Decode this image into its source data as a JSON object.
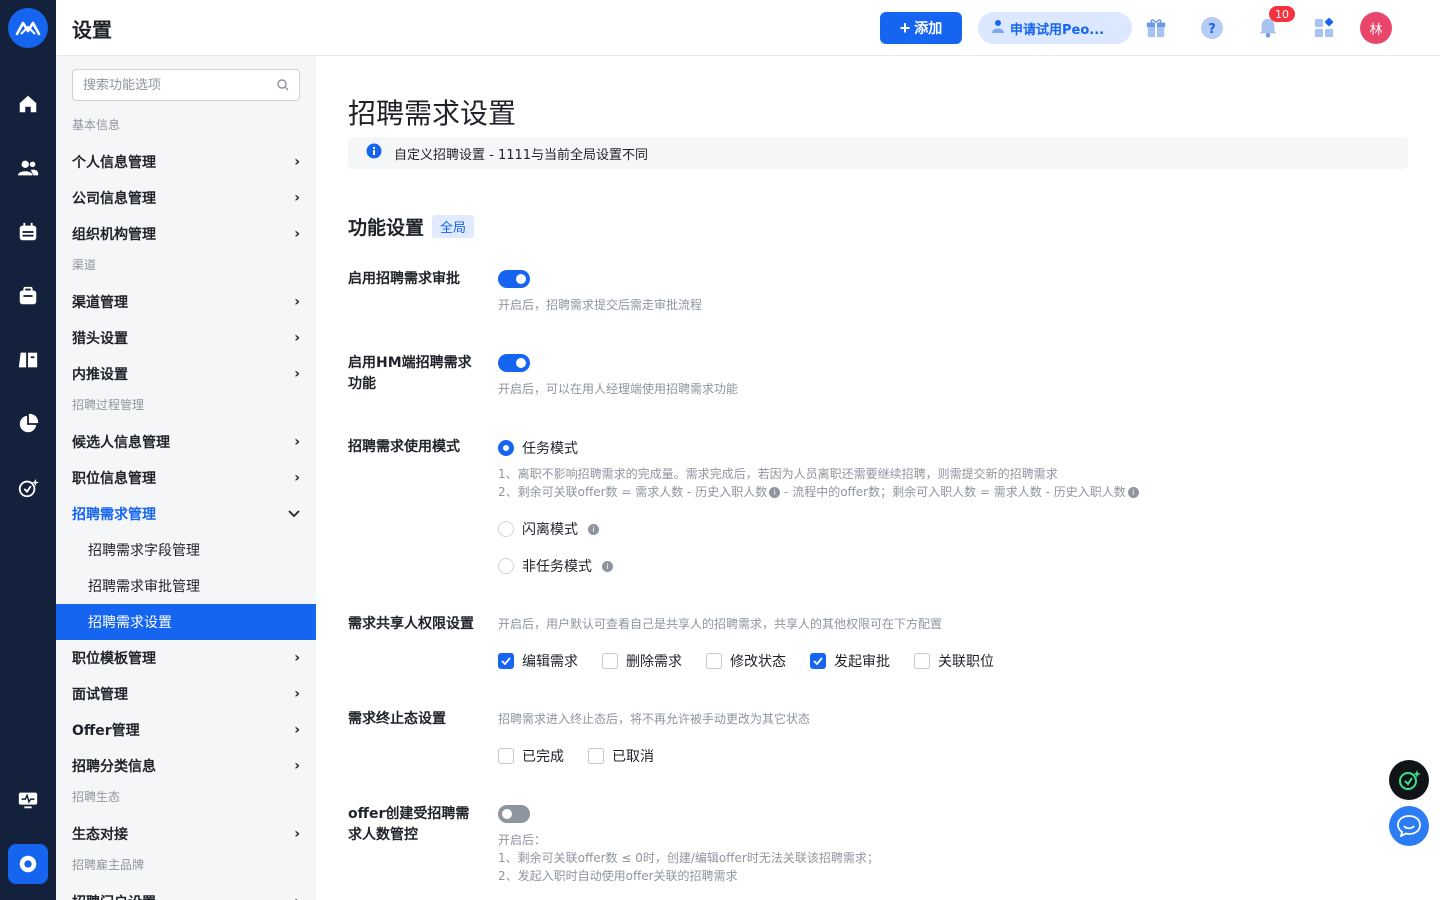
{
  "header": {
    "title": "设置",
    "add_label": "添加",
    "trial_label": "申请试用Peo...",
    "notification_count": "10",
    "avatar_text": "林"
  },
  "sidebar": {
    "search_placeholder": "搜索功能选项",
    "sections": [
      {
        "title": "基本信息",
        "items": [
          "个人信息管理",
          "公司信息管理",
          "组织机构管理"
        ]
      },
      {
        "title": "渠道",
        "items": [
          "渠道管理",
          "猎头设置",
          "内推设置"
        ]
      },
      {
        "title": "招聘过程管理",
        "items": [
          "候选人信息管理",
          "职位信息管理",
          "招聘需求管理"
        ],
        "open_item": "招聘需求管理",
        "sub_items": [
          "招聘需求字段管理",
          "招聘需求审批管理",
          "招聘需求设置"
        ],
        "selected_sub": "招聘需求设置",
        "after_items": [
          "职位模板管理",
          "面试管理",
          "Offer管理",
          "招聘分类信息"
        ]
      },
      {
        "title": "招聘生态",
        "items": [
          "生态对接"
        ]
      },
      {
        "title": "招聘雇主品牌",
        "items": [
          "招聘门户设置"
        ]
      }
    ]
  },
  "main": {
    "title": "招聘需求设置",
    "notice": "自定义招聘设置 - 1111与当前全局设置不同",
    "section_title": "功能设置",
    "section_tag": "全局",
    "approval": {
      "label": "启用招聘需求审批",
      "enabled": true,
      "hint": "开启后，招聘需求提交后需走审批流程"
    },
    "hm": {
      "label": "启用HM端招聘需求功能",
      "enabled": true,
      "hint": "开启后，可以在用人经理端使用招聘需求功能"
    },
    "mode": {
      "label": "招聘需求使用模式",
      "options": [
        "任务模式",
        "闪离模式",
        "非任务模式"
      ],
      "selected": "任务模式",
      "desc_line1": "1、离职不影响招聘需求的完成量。需求完成后，若因为人员离职还需要继续招聘，则需提交新的招聘需求",
      "desc_line2a": "2、剩余可关联offer数 = 需求人数 - 历史入职人数",
      "desc_line2b": "- 流程中的offer数；剩余可入职人数 = 需求人数 - 历史入职人数"
    },
    "share": {
      "label": "需求共享人权限设置",
      "hint": "开启后，用户默认可查看自己是共享人的招聘需求，共享人的其他权限可在下方配置",
      "options": [
        {
          "label": "编辑需求",
          "checked": true
        },
        {
          "label": "删除需求",
          "checked": false
        },
        {
          "label": "修改状态",
          "checked": false
        },
        {
          "label": "发起审批",
          "checked": true
        },
        {
          "label": "关联职位",
          "checked": false
        }
      ]
    },
    "terminal": {
      "label": "需求终止态设置",
      "hint": "招聘需求进入终止态后，将不再允许被手动更改为其它状态",
      "options": [
        {
          "label": "已完成",
          "checked": false
        },
        {
          "label": "已取消",
          "checked": false
        }
      ]
    },
    "offer": {
      "label": "offer创建受招聘需求人数管控",
      "enabled": false,
      "hint_title": "开启后：",
      "hint_line1": "1、剩余可关联offer数 ≤ 0时，创建/编辑offer时无法关联该招聘需求；",
      "hint_line2": "2、发起入职时自动使用offer关联的招聘需求"
    }
  },
  "colors": {
    "primary": "#1565f0",
    "rail": "#14213d",
    "sidebar_bg": "#f5f6f8"
  }
}
